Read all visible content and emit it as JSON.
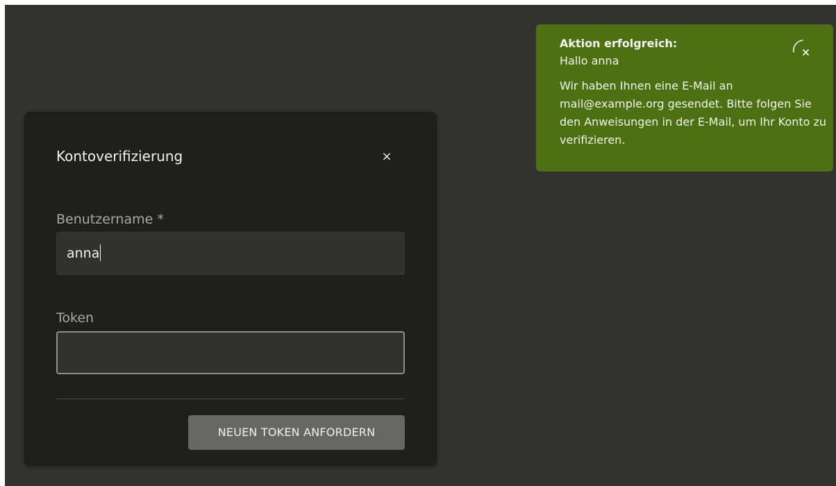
{
  "dialog": {
    "title": "Kontoverifizierung",
    "close_glyph": "×",
    "username": {
      "label": "Benutzername *",
      "value": "anna"
    },
    "token": {
      "label": "Token",
      "value": ""
    },
    "submit_label": "NEUEN TOKEN ANFORDERN"
  },
  "toast": {
    "title": "Aktion erfolgreich:",
    "subtitle": "Hallo anna",
    "message": "Wir haben Ihnen eine E-Mail an mail@example.org gesendet. Bitte folgen Sie den Anweisungen in der E-Mail, um Ihr Konto zu verifizieren.",
    "close_icon": "close-icon",
    "color": "#4c7012"
  },
  "colors": {
    "background": "#323230",
    "dialog": "#1e1e1d",
    "button": "#666664"
  }
}
